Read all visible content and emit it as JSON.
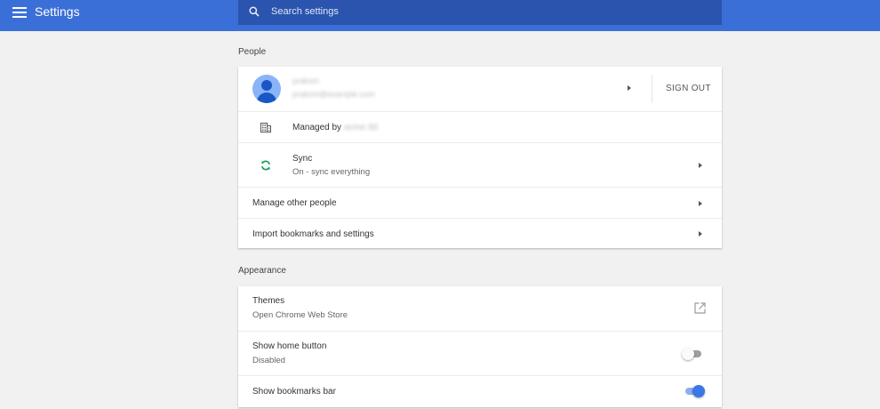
{
  "header": {
    "title": "Settings",
    "menu_icon": "hamburger-menu-icon",
    "search": {
      "placeholder": "Search settings",
      "value": "",
      "icon": "search-icon"
    }
  },
  "people": {
    "section_title": "People",
    "account": {
      "name": "prakom",
      "email": "prakom@example.com",
      "sign_out_label": "SIGN OUT",
      "avatar_icon": "person-avatar-icon"
    },
    "managed": {
      "label": "Managed by",
      "domain": "acme.tld",
      "icon": "building-icon"
    },
    "sync": {
      "label": "Sync",
      "status": "On - sync everything",
      "icon": "sync-icon",
      "icon_color": "#0f9d58"
    },
    "manage_other_people": "Manage other people",
    "import_bookmarks": "Import bookmarks and settings"
  },
  "appearance": {
    "section_title": "Appearance",
    "themes": {
      "label": "Themes",
      "sublabel": "Open Chrome Web Store",
      "icon": "open-in-new-icon"
    },
    "home_button": {
      "label": "Show home button",
      "sublabel": "Disabled",
      "enabled": false
    },
    "bookmarks_bar": {
      "label": "Show bookmarks bar",
      "enabled": true
    }
  },
  "colors": {
    "header_bg": "#3b6fd8",
    "search_bg": "#2a54ad",
    "accent": "#3b78e7",
    "page_bg": "#f1f1f1"
  }
}
